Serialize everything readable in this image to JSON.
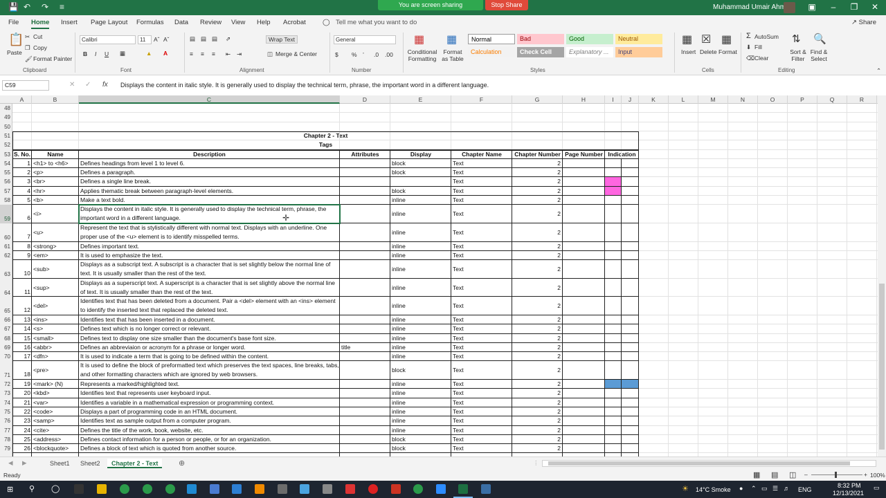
{
  "window": {
    "share_banner": "You are screen sharing",
    "stop_share": "Stop Share",
    "user_name": "Muhammad Umair Ahmad"
  },
  "ribbon_tabs": [
    "File",
    "Home",
    "Insert",
    "Page Layout",
    "Formulas",
    "Data",
    "Review",
    "View",
    "Help",
    "Acrobat"
  ],
  "tell_me": "Tell me what you want to do",
  "share_label": "Share",
  "ribbon": {
    "paste": "Paste",
    "cut": "Cut",
    "copy": "Copy",
    "format_painter": "Format Painter",
    "clipboard": "Clipboard",
    "font_name": "Calibri",
    "font_size": "11",
    "font": "Font",
    "wrap_text": "Wrap Text",
    "merge_center": "Merge & Center",
    "alignment": "Alignment",
    "number_format": "General",
    "number": "Number",
    "conditional_formatting": "Conditional Formatting",
    "format_as_table": "Format as Table",
    "style_cells": [
      {
        "label": "Normal",
        "bg": "#ffffff",
        "fg": "#000000"
      },
      {
        "label": "Bad",
        "bg": "#ffc7ce",
        "fg": "#9c0006"
      },
      {
        "label": "Good",
        "bg": "#c6efce",
        "fg": "#006100"
      },
      {
        "label": "Neutral",
        "bg": "#ffeb9c",
        "fg": "#9c5700"
      },
      {
        "label": "Calculation",
        "bg": "#f2f2f2",
        "fg": "#fa7d00"
      },
      {
        "label": "Check Cell",
        "bg": "#a5a5a5",
        "fg": "#ffffff"
      },
      {
        "label": "Explanatory ...",
        "bg": "#ffffff",
        "fg": "#7f7f7f"
      },
      {
        "label": "Input",
        "bg": "#ffcc99",
        "fg": "#3f3f76"
      }
    ],
    "styles": "Styles",
    "insert": "Insert",
    "delete": "Delete",
    "format": "Format",
    "cells": "Cells",
    "autosum": "AutoSum",
    "fill": "Fill",
    "clear": "Clear",
    "sort_filter": "Sort & Filter",
    "find_select": "Find & Select",
    "editing": "Editing"
  },
  "formula_bar": {
    "name_box": "C59",
    "fx": "fx",
    "content": "Displays the content in italic style. It is generally used to display the technical term, phrase, the important word in a different language."
  },
  "columns": [
    "A",
    "B",
    "C",
    "D",
    "E",
    "F",
    "G",
    "H",
    "I",
    "J",
    "K",
    "L",
    "M",
    "N",
    "O",
    "P",
    "Q",
    "R"
  ],
  "sheet": {
    "title": "Chapter 2 - Text",
    "subtitle": "Tags",
    "headers": [
      "S. No.",
      "Name",
      "Description",
      "Attributes",
      "Display",
      "Chapter Name",
      "Chapter Number",
      "Page Number",
      "Indication"
    ],
    "empty_rows": [
      "48",
      "49",
      "50"
    ],
    "title_row": "51",
    "subtitle_row": "52",
    "header_row": "53",
    "rows": [
      {
        "row": "54",
        "sno": "1",
        "name": "<h1> to <h6>",
        "desc": "Defines headings from level 1 to level 6.",
        "attr": "",
        "display": "block",
        "chapter": "Text",
        "chnum": "2"
      },
      {
        "row": "55",
        "sno": "2",
        "name": "<p>",
        "desc": "Defines a paragraph.",
        "attr": "",
        "display": "block",
        "chapter": "Text",
        "chnum": "2"
      },
      {
        "row": "56",
        "sno": "3",
        "name": "<br>",
        "desc": "Defines a single line break.",
        "attr": "",
        "display": "",
        "chapter": "Text",
        "chnum": "2"
      },
      {
        "row": "57",
        "sno": "4",
        "name": "<hr>",
        "desc": "Applies thematic break between paragraph-level elements.",
        "attr": "",
        "display": "block",
        "chapter": "Text",
        "chnum": "2"
      },
      {
        "row": "58",
        "sno": "5",
        "name": "<b>",
        "desc": "Make a text bold.",
        "attr": "",
        "display": "inline",
        "chapter": "Text",
        "chnum": "2"
      },
      {
        "row": "59",
        "sno": "6",
        "name": "<i>",
        "desc": "Displays the content in italic style. It is generally used to display the technical term, phrase, the important word in a different language.",
        "attr": "",
        "display": "inline",
        "chapter": "Text",
        "chnum": "2"
      },
      {
        "row": "60",
        "sno": "7",
        "name": "<u>",
        "desc": "Represent the text that is stylistically different with normal text. Displays with an underline. One proper use of the <u> element is to identify misspelled terms.",
        "attr": "",
        "display": "inline",
        "chapter": "Text",
        "chnum": "2"
      },
      {
        "row": "61",
        "sno": "8",
        "name": "<strong>",
        "desc": "Defines important text.",
        "attr": "",
        "display": "inline",
        "chapter": "Text",
        "chnum": "2"
      },
      {
        "row": "62",
        "sno": "9",
        "name": "<em>",
        "desc": "It is used to emphasize the text.",
        "attr": "",
        "display": "inline",
        "chapter": "Text",
        "chnum": "2"
      },
      {
        "row": "63",
        "sno": "10",
        "name": "<sub>",
        "desc": "Displays as a subscript text. A subscript is a character that is set slightly below the normal line of text. It is usually smaller than the rest of the text.",
        "attr": "",
        "display": "inline",
        "chapter": "Text",
        "chnum": "2"
      },
      {
        "row": "64",
        "sno": "11",
        "name": "<sup>",
        "desc": "Displays as a superscript text. A superscript is a character that is set slightly above the normal line of text. It is usually smaller than the rest of the text.",
        "attr": "",
        "display": "inline",
        "chapter": "Text",
        "chnum": "2"
      },
      {
        "row": "65",
        "sno": "12",
        "name": "<del>",
        "desc": "Identifies text that has been deleted from a document. Pair a <del> element with an <ins> element to identify the inserted text that replaced the deleted text.",
        "attr": "",
        "display": "inline",
        "chapter": "Text",
        "chnum": "2"
      },
      {
        "row": "66",
        "sno": "13",
        "name": "<ins>",
        "desc": "Identifies text that has been inserted in a document.",
        "attr": "",
        "display": "inline",
        "chapter": "Text",
        "chnum": "2"
      },
      {
        "row": "67",
        "sno": "14",
        "name": "<s>",
        "desc": "Defines text which is no longer correct or relevant.",
        "attr": "",
        "display": "inline",
        "chapter": "Text",
        "chnum": "2"
      },
      {
        "row": "68",
        "sno": "15",
        "name": "<small>",
        "desc": "Defines text to display one size smaller than the document's base font size.",
        "attr": "",
        "display": "inline",
        "chapter": "Text",
        "chnum": "2"
      },
      {
        "row": "69",
        "sno": "16",
        "name": "<abbr>",
        "desc": "Defines an abbreviaion or acronym for a phrase or longer word.",
        "attr": "title",
        "display": "inline",
        "chapter": "Text",
        "chnum": "2"
      },
      {
        "row": "70",
        "sno": "17",
        "name": "<dfn>",
        "desc": "It is used to indicate a term that is going to be defined within the content.",
        "attr": "",
        "display": "inline",
        "chapter": "Text",
        "chnum": "2"
      },
      {
        "row": "71",
        "sno": "18",
        "name": "<pre>",
        "desc": "It is used to define the block of preformatted text which preserves the text spaces, line breaks, tabs, and other formatting characters which are ignored by web browsers.",
        "attr": "",
        "display": "block",
        "chapter": "Text",
        "chnum": "2"
      },
      {
        "row": "72",
        "sno": "19",
        "name": "<mark> (N)",
        "desc": "Represents a marked/highlighted text.",
        "attr": "",
        "display": "inline",
        "chapter": "Text",
        "chnum": "2"
      },
      {
        "row": "73",
        "sno": "20",
        "name": "<kbd>",
        "desc": "Identifies text that represents user keyboard input.",
        "attr": "",
        "display": "inline",
        "chapter": "Text",
        "chnum": "2"
      },
      {
        "row": "74",
        "sno": "21",
        "name": "<var>",
        "desc": "Identifies a variable in a mathematical expression or programming context.",
        "attr": "",
        "display": "inline",
        "chapter": "Text",
        "chnum": "2"
      },
      {
        "row": "75",
        "sno": "22",
        "name": "<code>",
        "desc": "Displays a part of programming code in an HTML document.",
        "attr": "",
        "display": "inline",
        "chapter": "Text",
        "chnum": "2"
      },
      {
        "row": "76",
        "sno": "23",
        "name": "<samp>",
        "desc": "Identifies text as sample output from a computer program.",
        "attr": "",
        "display": "inline",
        "chapter": "Text",
        "chnum": "2"
      },
      {
        "row": "77",
        "sno": "24",
        "name": "<cite>",
        "desc": "Defines the title of the work, book, website, etc.",
        "attr": "",
        "display": "inline",
        "chapter": "Text",
        "chnum": "2"
      },
      {
        "row": "78",
        "sno": "25",
        "name": "<address>",
        "desc": "Defines contact information for a person or people, or for an organization.",
        "attr": "",
        "display": "block",
        "chapter": "Text",
        "chnum": "2"
      },
      {
        "row": "79",
        "sno": "26",
        "name": "<blockquote>",
        "desc": "Defines a block of text which is quoted from another source.",
        "attr": "",
        "display": "block",
        "chapter": "Text",
        "chnum": "2"
      }
    ],
    "indications": {
      "56": "#ff66e0",
      "57": "#ff66e0",
      "72": "#5b9bd5"
    }
  },
  "sheet_tabs": [
    "Sheet1",
    "Sheet2",
    "Chapter 2 - Text"
  ],
  "active_sheet": "Chapter 2 - Text",
  "status": {
    "ready": "Ready",
    "zoom": "100%"
  },
  "taskbar": {
    "weather": "14°C  Smoke",
    "language": "ENG",
    "time": "8:32 PM",
    "date": "12/13/2021"
  }
}
